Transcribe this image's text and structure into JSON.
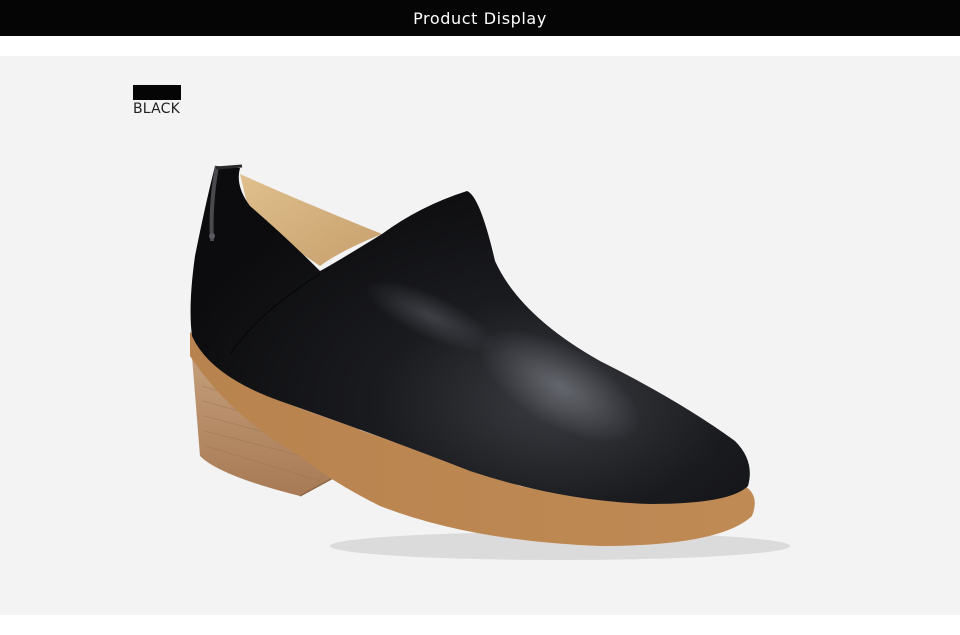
{
  "header": {
    "title": "Product Display"
  },
  "product": {
    "color_name": "BLACK",
    "swatch_color": "#050505",
    "image": "black-ankle-shoe-icon"
  },
  "colors": {
    "header_bg": "#050505",
    "stage_bg": "#f3f3f3"
  }
}
